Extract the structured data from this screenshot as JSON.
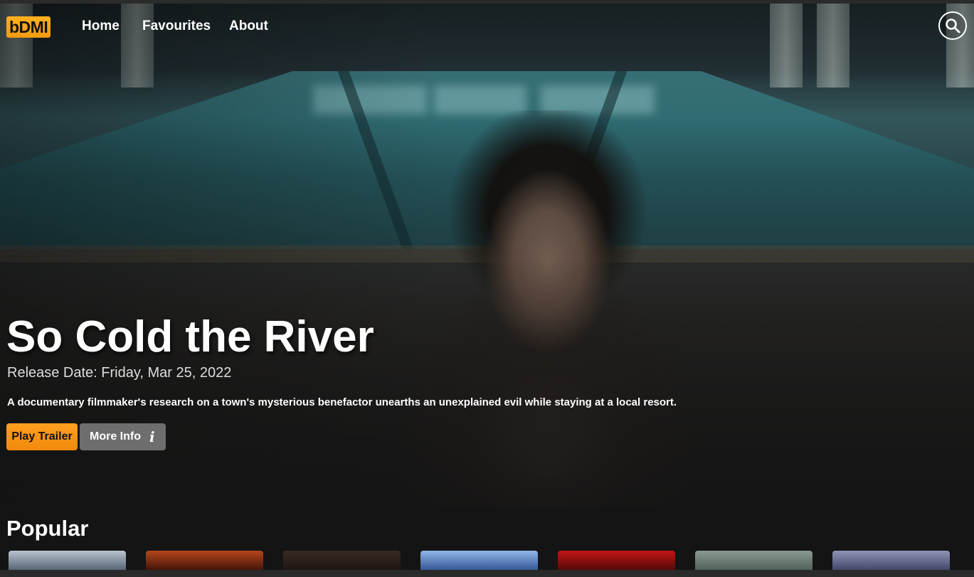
{
  "nav": {
    "logo": "bDMI",
    "links": [
      "Home",
      "Favourites",
      "About"
    ]
  },
  "hero": {
    "title": "So Cold the River",
    "release": "Release Date: Friday, Mar 25, 2022",
    "overview": "A documentary filmmaker's research on a town's mysterious benefactor unearths an unexplained evil while staying at a local resort.",
    "play_label": "Play Trailer",
    "info_label": "More Info",
    "info_icon": "i"
  },
  "popular": {
    "title": "Popular",
    "posters": [
      {
        "icon": "poster-thumbnail",
        "colors": [
          "#b9c3cf",
          "#4f5a6a"
        ]
      },
      {
        "icon": "poster-thumbnail",
        "colors": [
          "#b5471c",
          "#3a0f08"
        ]
      },
      {
        "icon": "poster-thumbnail",
        "colors": [
          "#3a2a22",
          "#1a1410"
        ]
      },
      {
        "icon": "poster-thumbnail",
        "colors": [
          "#8fb7e8",
          "#2c4d8f"
        ]
      },
      {
        "icon": "poster-thumbnail",
        "colors": [
          "#c21515",
          "#4a0808"
        ]
      },
      {
        "icon": "poster-thumbnail",
        "colors": [
          "#8b9a92",
          "#4c5a55"
        ]
      },
      {
        "icon": "poster-thumbnail",
        "colors": [
          "#8e95b5",
          "#3a3f62"
        ]
      }
    ]
  },
  "colors": {
    "accent": "#f7a01a",
    "info_button": "#6e6e6e",
    "background": "#141414"
  }
}
